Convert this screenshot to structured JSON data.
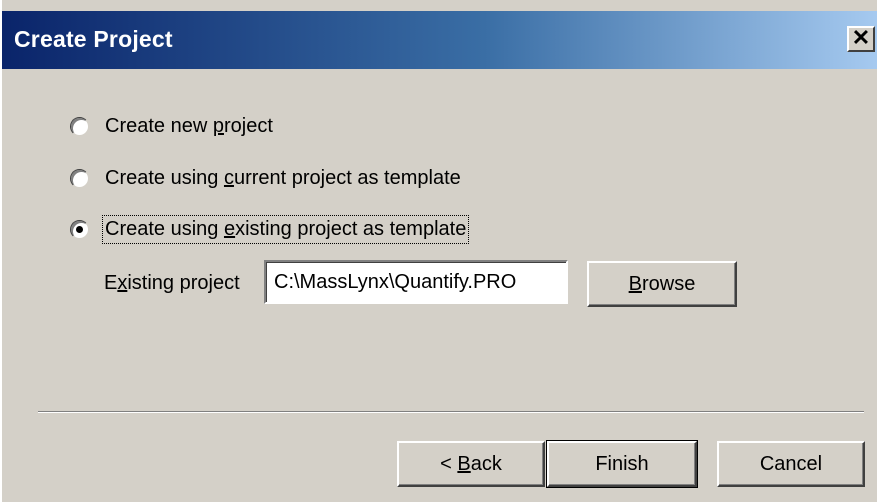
{
  "dialog": {
    "title": "Create Project",
    "close_glyph": "✕"
  },
  "options": [
    {
      "pre": "Create new ",
      "accel": "p",
      "post": "roject",
      "checked": false
    },
    {
      "pre": "Create using ",
      "accel": "c",
      "post": "urrent project as template",
      "checked": false
    },
    {
      "pre": "Create using ",
      "accel": "e",
      "post": "xisting project as template",
      "checked": true
    }
  ],
  "existing_project": {
    "label_pre": "E",
    "label_accel": "x",
    "label_post": "isting project",
    "value": "C:\\MassLynx\\Quantify.PRO"
  },
  "buttons": {
    "browse": {
      "accel": "B",
      "post": "rowse"
    },
    "back": {
      "pre": "< ",
      "accel": "B",
      "post": "ack"
    },
    "finish": "Finish",
    "cancel": "Cancel"
  }
}
